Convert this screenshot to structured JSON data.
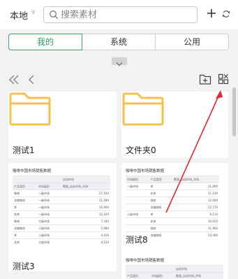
{
  "header": {
    "location_label": "本地",
    "search_placeholder": "搜索素材"
  },
  "tabs": [
    {
      "label": "我的",
      "active": true
    },
    {
      "label": "系统",
      "active": false
    },
    {
      "label": "公用",
      "active": false
    }
  ],
  "colors": {
    "accent": "#3aa867",
    "folder": "#f3c052",
    "annotation_arrow": "#e8262b"
  },
  "items": [
    {
      "label": "测试1",
      "kind": "folder"
    },
    {
      "label": "文件夹0",
      "kind": "folder"
    },
    {
      "label": "测试3",
      "kind": "sheet"
    },
    {
      "label": "测试8",
      "kind": "sheet"
    },
    {
      "label": "",
      "kind": "sheet"
    }
  ],
  "sheet_preview_a": {
    "title": "咖啡中国市场销售数据",
    "group_header": "自动市场",
    "columns": [
      "产品类别",
      "市场级别",
      "数量_自动市场_市场"
    ],
    "rows": [
      [
        "咖啡",
        "一级市场",
        "27,160"
      ],
      [
        "浓缩咖啡",
        "一级市场",
        "21,280"
      ],
      [
        "茶",
        "一级市场",
        "16,900"
      ],
      [
        "花茶",
        "一级市场",
        "12,320"
      ],
      [
        "咖啡",
        "二级市场",
        "7,340"
      ],
      [
        "浓缩咖啡",
        "二级市场",
        "5,980"
      ],
      [
        "茶",
        "二级市场",
        "4,420"
      ],
      [
        "花茶",
        "二级市场",
        "4,120"
      ]
    ]
  },
  "sheet_preview_b": {
    "title": "咖啡中国市场销售数据",
    "columns": [
      "市场级别",
      "产品类别",
      "数量_自动市场_市场"
    ],
    "rows": [
      [
        "一级市场",
        "茶",
        "11,660"
      ],
      [
        "",
        "花茶",
        "11,140"
      ],
      [
        "",
        "咖啡",
        "12,000"
      ],
      [
        "",
        "浓缩咖啡",
        "12,770"
      ],
      [
        "二级市场",
        "茶",
        "9,110"
      ],
      [
        "",
        "花茶",
        "10,020"
      ],
      [
        "",
        "咖啡",
        "11,960"
      ],
      [
        "",
        "浓缩咖啡",
        "13,490"
      ]
    ]
  },
  "sheet_preview_c": {
    "title": "咖啡中国市场销售数据",
    "group_header": "自动市场",
    "columns": [
      "产品类别",
      "市场级别",
      "数量_自动市场_市场"
    ]
  }
}
